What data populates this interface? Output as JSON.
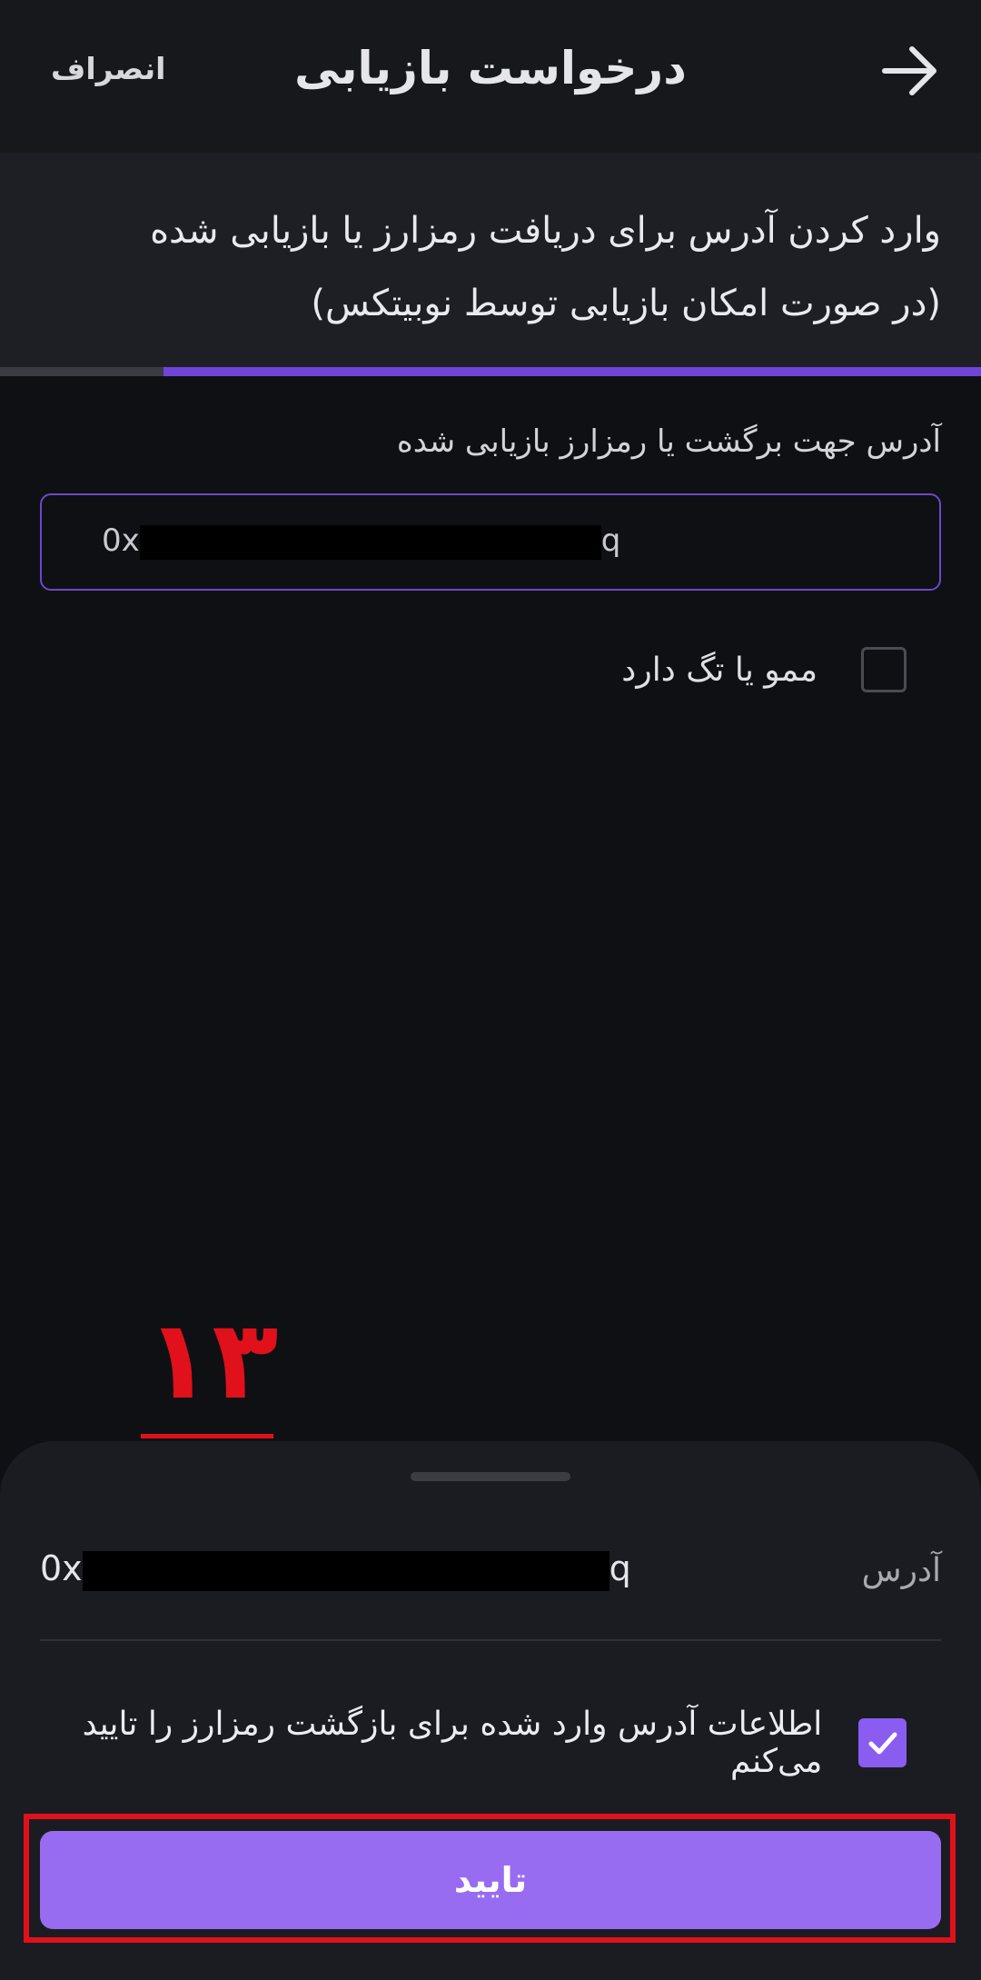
{
  "header": {
    "title": "درخواست بازیابی",
    "cancel_label": "انصراف"
  },
  "step": {
    "text": "وارد کردن آدرس برای دریافت رمزارز یا بازیابی شده (در صورت امکان بازیابی توسط نوبیتکس)",
    "progress_fraction": 0.833
  },
  "form": {
    "address_label": "آدرس جهت برگشت یا رمزارز بازیابی شده",
    "address_prefix": "0x",
    "address_suffix": "q",
    "memo_label": "ممو یا تگ دارد",
    "memo_checked": false
  },
  "annotation": {
    "number": "۱۳",
    "color": "#e0111a"
  },
  "sheet": {
    "address_label": "آدرس",
    "address_prefix": "0x",
    "address_suffix": "q",
    "confirm_text": "اطلاعات آدرس وارد شده برای بازگشت رمزارز را تایید می‌کنم",
    "confirm_checked": true,
    "submit_label": "تایید"
  },
  "colors": {
    "accent": "#986cf0",
    "background": "#0f1013",
    "annotation": "#e0111a"
  },
  "icons": {
    "back": "arrow-right-icon",
    "check": "checkmark-icon"
  }
}
